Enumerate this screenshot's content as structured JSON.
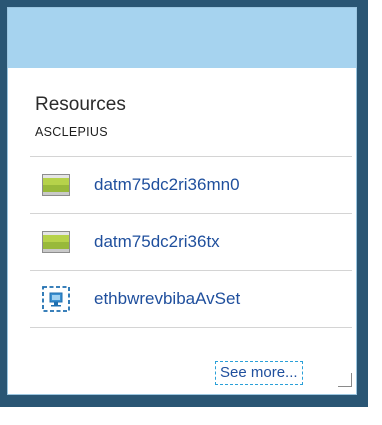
{
  "tile": {
    "title": "Resources",
    "subtitle": "ASCLEPIUS",
    "items": [
      {
        "label": "datm75dc2ri36mn0",
        "icon": "storage-account-icon"
      },
      {
        "label": "datm75dc2ri36tx",
        "icon": "storage-account-icon"
      },
      {
        "label": "ethbwrevbibaAvSet",
        "icon": "availability-set-icon"
      }
    ],
    "see_more_label": "See more..."
  },
  "colors": {
    "frame": "#2a5674",
    "tile_top": "#a6d3ef",
    "link": "#1f4f9d",
    "focus_dash": "#2aa0d8",
    "storage_green": "#a8c63f"
  }
}
